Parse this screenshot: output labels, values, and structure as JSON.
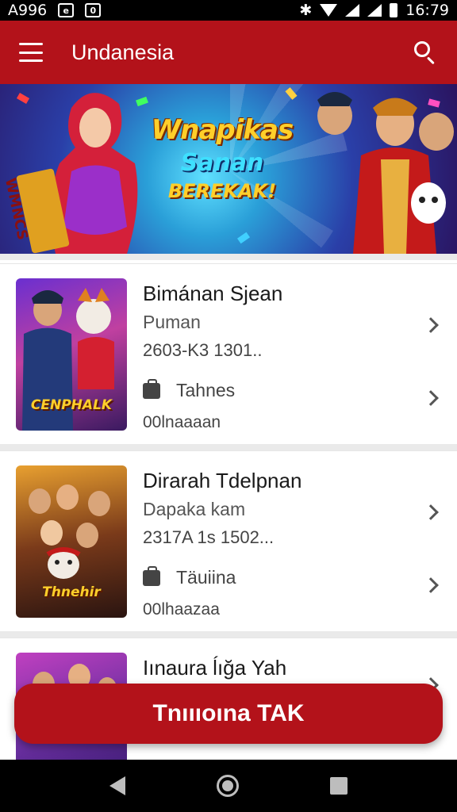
{
  "status_bar": {
    "time_left": "A996",
    "time_right": "16:79",
    "notif_a": "e",
    "notif_b": "0"
  },
  "app_bar": {
    "title": "Undanesia"
  },
  "banner": {
    "line1": "Wnapikas",
    "line2": "Sanan",
    "line3": "BEREKAK!",
    "sign": "WMNCS"
  },
  "items": [
    {
      "title": "Bimánan Sjean",
      "subtitle": "Puman",
      "meta": "2603-K3 1301..",
      "tag": "Tahnes",
      "footer": "00lnaaaan",
      "thumb_label": "CENPHALK"
    },
    {
      "title": "Dirarah Tdelpnan",
      "subtitle": "Dapaka kam",
      "meta": "2317A 1s 1502...",
      "tag": "Täuiina",
      "footer": "00lhaazaa",
      "thumb_label": "Thnehir"
    },
    {
      "title": "Iınaura ĺığa Yah",
      "subtitle": "",
      "meta": "",
      "tag": "",
      "footer": "",
      "thumb_label": ""
    }
  ],
  "cta": {
    "label": "Tnıııoına TAK"
  },
  "colors": {
    "primary": "#b3121a",
    "status_bar": "#000000"
  }
}
